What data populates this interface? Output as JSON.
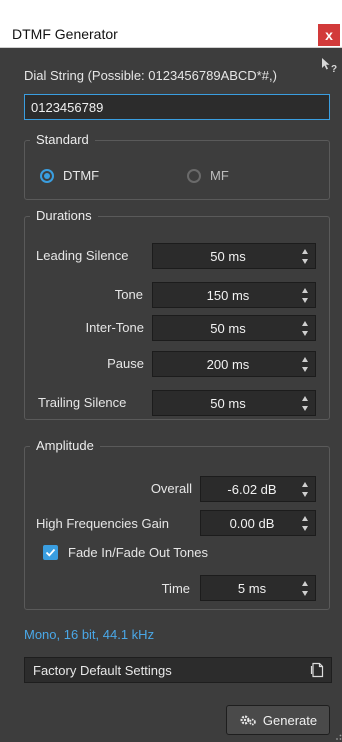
{
  "window": {
    "title": "DTMF Generator",
    "close_glyph": "x"
  },
  "dial": {
    "label": "Dial String (Possible: 0123456789ABCD*#,)",
    "value": "0123456789"
  },
  "standard": {
    "title": "Standard",
    "options": [
      {
        "label": "DTMF",
        "selected": true
      },
      {
        "label": "MF",
        "selected": false
      }
    ]
  },
  "durations": {
    "title": "Durations",
    "rows": [
      {
        "label": "Leading Silence",
        "value": "50 ms"
      },
      {
        "label": "Tone",
        "value": "150 ms"
      },
      {
        "label": "Inter-Tone",
        "value": "50 ms"
      },
      {
        "label": "Pause",
        "value": "200 ms"
      },
      {
        "label": "Trailing Silence",
        "value": "50 ms"
      }
    ]
  },
  "amplitude": {
    "title": "Amplitude",
    "overall_label": "Overall",
    "overall_value": "-6.02 dB",
    "hf_label": "High Frequencies Gain",
    "hf_value": "0.00 dB",
    "fade_label": "Fade In/Fade Out Tones",
    "fade_checked": true,
    "time_label": "Time",
    "time_value": "5 ms"
  },
  "status": "Mono, 16 bit, 44.1 kHz",
  "preset": {
    "label": "Factory Default Settings"
  },
  "generate": {
    "label": "Generate"
  },
  "colors": {
    "accent": "#3a9ee0",
    "close": "#d23a3a",
    "panel": "#3d3d3d",
    "field": "#2b2b2b"
  },
  "icons": [
    "close-icon",
    "help-cursor-icon",
    "radio-icon",
    "spin-arrows-icon",
    "checkmark-icon",
    "preset-icon",
    "gears-icon",
    "resize-grip-icon"
  ]
}
